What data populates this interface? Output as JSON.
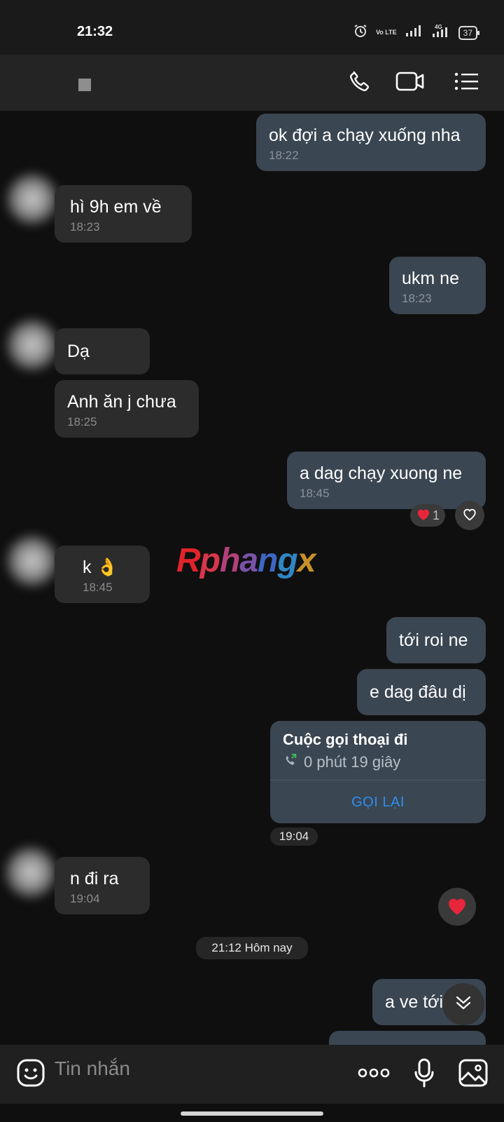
{
  "status_bar": {
    "time": "21:32",
    "battery": "37",
    "network": "4G",
    "volte": "Vo LTE"
  },
  "header": {
    "call_icon": "phone-icon",
    "video_icon": "video-camera-icon",
    "menu_icon": "list-menu-icon"
  },
  "messages": [
    {
      "dir": "out",
      "text": "ok đợi a chạy xuống nha",
      "time": "18:22"
    },
    {
      "dir": "in",
      "text": "hì 9h em về",
      "time": "18:23"
    },
    {
      "dir": "out",
      "text": "ukm ne",
      "time": "18:23"
    },
    {
      "dir": "in",
      "text": "Dạ",
      "time": ""
    },
    {
      "dir": "in",
      "text": "Anh ăn j chưa",
      "time": "18:25"
    },
    {
      "dir": "out",
      "text": "a dag chạy xuong ne",
      "time": "18:45",
      "reaction_count": "1"
    },
    {
      "dir": "in",
      "text": "k 👌",
      "time": "18:45"
    },
    {
      "dir": "out",
      "text": "tới roi ne",
      "time": ""
    },
    {
      "dir": "out",
      "text": "e dag đâu dị",
      "time": ""
    },
    {
      "dir": "in",
      "text": "n đi ra",
      "time": "19:04"
    },
    {
      "dir": "out",
      "text": "a ve tới",
      "time": ""
    }
  ],
  "call_card": {
    "title": "Cuộc gọi thoại đi",
    "duration": "0 phút 19 giây",
    "action": "GỌI LẠI",
    "time": "19:04"
  },
  "date_divider": "21:12 Hôm nay",
  "watermark": "Rphangx",
  "input": {
    "placeholder": "Tin nhắn"
  },
  "colors": {
    "outgoing_bubble": "#3a4652",
    "incoming_bubble": "#2c2c2c",
    "link": "#2f8ff0",
    "background": "#0f0f0f"
  }
}
